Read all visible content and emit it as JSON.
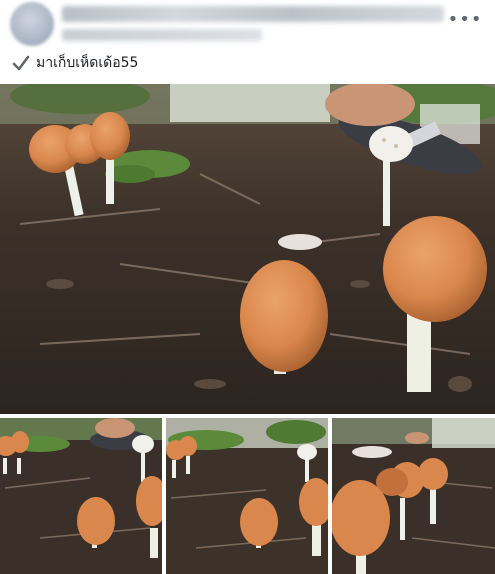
{
  "post": {
    "more_glyph": "•••",
    "caption": "มาเก็บเห็ดเด้อ55",
    "caption_icon": "check-mark-icon"
  },
  "photos": [
    {
      "name": "main-photo",
      "subject": "mushrooms"
    },
    {
      "name": "thumbnail-1",
      "subject": "mushrooms"
    },
    {
      "name": "thumbnail-2",
      "subject": "mushrooms"
    },
    {
      "name": "thumbnail-3",
      "subject": "mushrooms"
    }
  ],
  "colors": {
    "mushroom_cap": "#d9874c",
    "mushroom_stem": "#eef0ea",
    "soil": "#3a3029",
    "foliage": "#5b8a3a"
  }
}
